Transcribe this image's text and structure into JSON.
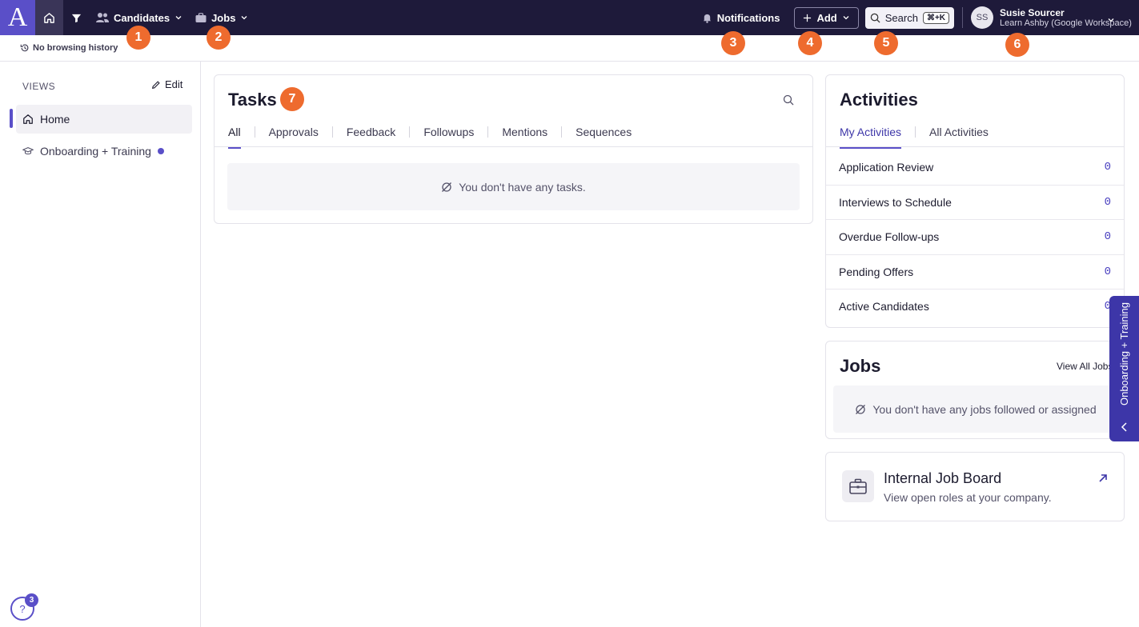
{
  "topbar": {
    "logo": "A",
    "candidates_label": "Candidates",
    "jobs_label": "Jobs",
    "notifications_label": "Notifications",
    "add_label": "Add",
    "search_label": "Search",
    "search_shortcut": "⌘+K",
    "user_initials": "SS",
    "user_name": "Susie Sourcer",
    "user_org": "Learn Ashby (Google Workspace)"
  },
  "badges": [
    "1",
    "2",
    "3",
    "4",
    "5",
    "6",
    "7"
  ],
  "history": {
    "label": "No browsing history"
  },
  "sidebar": {
    "views_header": "VIEWS",
    "edit_label": "Edit",
    "items": [
      {
        "label": "Home",
        "icon": "home-icon"
      },
      {
        "label": "Onboarding + Training",
        "icon": "graduation-cap-icon"
      }
    ]
  },
  "tasks": {
    "title": "Tasks",
    "tabs": [
      "All",
      "Approvals",
      "Feedback",
      "Followups",
      "Mentions",
      "Sequences"
    ],
    "empty_text": "You don't have any tasks."
  },
  "activities": {
    "title": "Activities",
    "tabs": [
      "My Activities",
      "All Activities"
    ],
    "rows": [
      {
        "label": "Application Review",
        "count": "0"
      },
      {
        "label": "Interviews to Schedule",
        "count": "0"
      },
      {
        "label": "Overdue Follow-ups",
        "count": "0"
      },
      {
        "label": "Pending Offers",
        "count": "0"
      },
      {
        "label": "Active Candidates",
        "count": "0"
      }
    ]
  },
  "jobs": {
    "title": "Jobs",
    "view_all": "View All Jobs",
    "empty_text": "You don't have any jobs followed or assigned"
  },
  "internal_board": {
    "title": "Internal Job Board",
    "subtitle": "View open roles at your company."
  },
  "onboarding_tab": {
    "label": "Onboarding + Training"
  },
  "help": {
    "symbol": "?",
    "count": "3"
  },
  "colors": {
    "accent": "#5a4fc8",
    "topbar": "#1e1a3a",
    "badge": "#ee6b2e"
  }
}
